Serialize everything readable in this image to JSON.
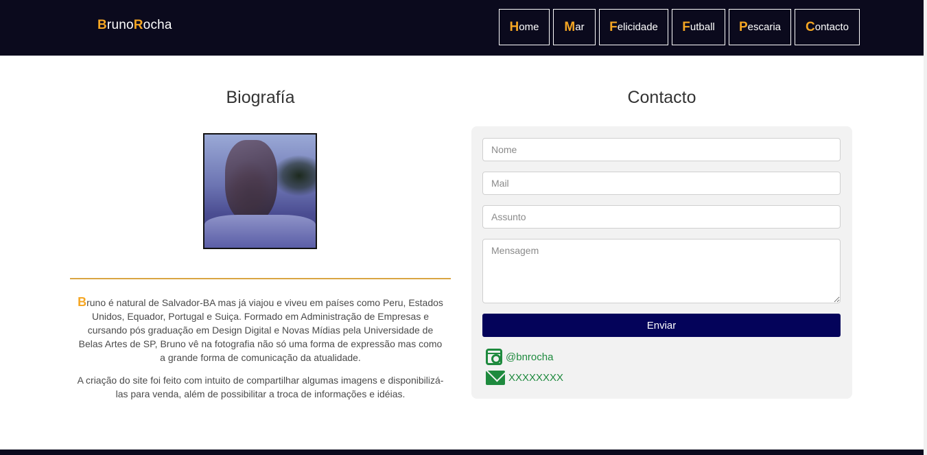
{
  "header": {
    "brand": {
      "first_initial": "B",
      "first_rest": "runo",
      "last_initial": "R",
      "last_rest": "ocha"
    },
    "nav": [
      {
        "initial": "H",
        "rest": "ome"
      },
      {
        "initial": "M",
        "rest": "ar"
      },
      {
        "initial": "F",
        "rest": "elicidade"
      },
      {
        "initial": "F",
        "rest": "utball"
      },
      {
        "initial": "P",
        "rest": "escaria"
      },
      {
        "initial": "C",
        "rest": "ontacto"
      }
    ]
  },
  "bio": {
    "title": "Biografía",
    "p1_initial": "B",
    "p1_rest": "runo é natural de Salvador-BA mas já viajou e viveu em países como Peru, Estados Unidos, Equador, Portugal e Suiça. Formado em Administração de Empresas e cursando pós graduação em Design Digital e Novas Mídias pela Universidade de Belas Artes de SP, Bruno vê na fotografia não só uma forma de expressão mas como a grande forma de comunicação da atualidade.",
    "p2": "A criação do site foi feito com intuito de compartilhar algumas imagens e disponibilizá-las para venda, além de possibilitar a troca de informações e idéias."
  },
  "contact": {
    "title": "Contacto",
    "fields": {
      "name_placeholder": "Nome",
      "mail_placeholder": "Mail",
      "subject_placeholder": "Assunto",
      "message_placeholder": "Mensagem"
    },
    "send_label": "Enviar",
    "instagram": "@bnrocha",
    "email": "XXXXXXXX"
  },
  "colors": {
    "navbar_bg": "#0b0a1d",
    "accent": "#f5a623",
    "button_bg": "#04035a",
    "social_green": "#1e8a3e",
    "divider": "#d9a441"
  }
}
